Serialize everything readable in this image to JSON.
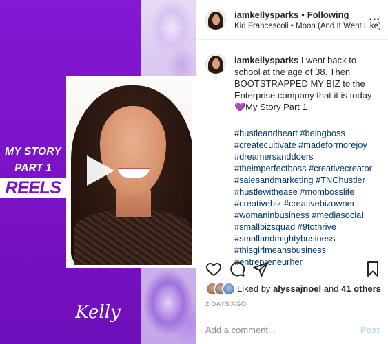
{
  "media": {
    "story_line1": "MY STORY",
    "story_line2": "PART 1",
    "reels_label": "REELS",
    "logo_text": "Kelly",
    "play_icon": "play-icon"
  },
  "header": {
    "username": "iamkellysparks",
    "separator": "•",
    "follow_state": "Following",
    "audio": "Kid Francescoli • Moon (And It Went Like)",
    "more_icon": "more-options-icon",
    "more_label": "..."
  },
  "caption": {
    "username": "iamkellysparks",
    "text": "I went back to school at the age of 38. Then BOOTSTRAPPED MY BIZ to the Enterprise company that it is today 💜My Story Part 1",
    "hashtags": [
      "#hustleandheart #beingboss",
      "#createcultivate #madeformorejoy",
      "#dreamersanddoers",
      "#theimperfectboss #creativecreator",
      "#salesandmarketing #TNChustler",
      "#hustlewithease #mombosslife",
      "#creativebiz #creativebizowner",
      "#womaninbusiness #mediasocial",
      "#smallbizsquad #9tothrive",
      "#smallandmightybusiness",
      "#thisgirlmeansbusiness",
      "#entrepreneurher"
    ]
  },
  "actions": {
    "icons": [
      "heart-icon",
      "comment-icon",
      "share-icon",
      "bookmark-icon"
    ],
    "liked_prefix": "Liked by",
    "liked_user": "alyssajnoel",
    "liked_and": "and",
    "liked_others": "41 others",
    "time_ago": "2 DAYS AGO"
  },
  "comment": {
    "placeholder": "Add a comment...",
    "post_label": "Post"
  },
  "colors": {
    "brand_purple": "#7a13c4",
    "hashtag_blue": "#00376b",
    "post_disabled": "#b2dffc",
    "muted_gray": "#8e8e8e"
  }
}
